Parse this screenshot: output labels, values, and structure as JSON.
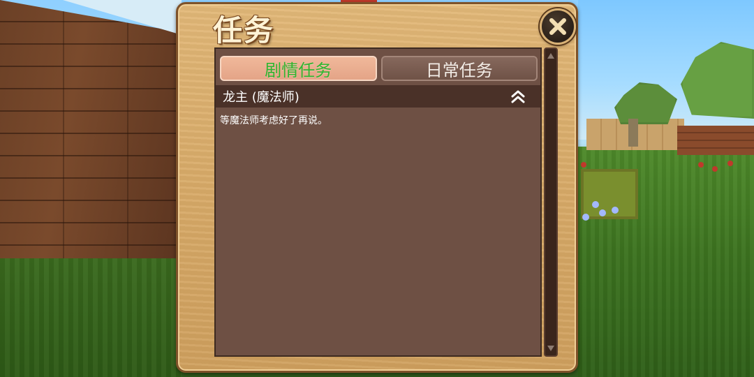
{
  "panel": {
    "title": "任务"
  },
  "tabs": [
    {
      "label": "剧情任务",
      "active": true
    },
    {
      "label": "日常任务",
      "active": false
    }
  ],
  "quest": {
    "name": "龙主 (魔法师)",
    "description": "等魔法师考虑好了再说。",
    "expanded": true
  },
  "colors": {
    "active_tab_text": "#2fb52f",
    "panel_wood": "#d8aa68",
    "content_bg": "#6e5044",
    "header_bg": "#4a3128"
  },
  "icons": {
    "close": "close-icon",
    "collapse": "chevron-up-double-icon",
    "scroll_up": "scroll-up-arrow-icon",
    "scroll_down": "scroll-down-arrow-icon"
  }
}
